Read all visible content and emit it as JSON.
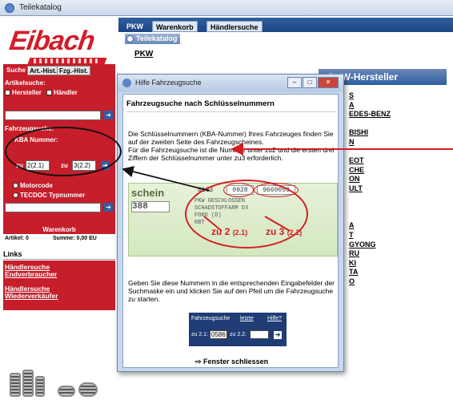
{
  "window": {
    "title": "Teilekatalog"
  },
  "sidebar": {
    "logo_text": "Eibach",
    "tabs": [
      "Suche",
      "Art.-Hist.",
      "Fzg.-Hist."
    ],
    "artikelsuche_label": "Artikelsuche:",
    "hersteller_label": "Hersteller",
    "haendler_label": "Händler",
    "fahrzeugsuche_label": "Fahrzeugsuche:",
    "kba_label": "KBA Nummer:",
    "kba_zu2_label": "zu",
    "kba_zu2_value": "2(2.1)",
    "kba_zu3_label": "zu",
    "kba_zu3_value": "3(2.2)",
    "motorcode_label": "Motorcode",
    "tecdoc_label": "TECDOC Typnummer",
    "warenkorb_label": "Warenkorb",
    "artikel_label": "Artikel: 0",
    "summe_label": "Summe: 0,00 EU",
    "links_label": "Links",
    "link1_line1": "Händlersuche",
    "link1_line2": "Endverbraucher",
    "link2_line1": "Händlersuche",
    "link2_line2": "Wiederverkäufer"
  },
  "main": {
    "tabs": [
      "PKW",
      "Warenkorb",
      "Händlersuche"
    ],
    "subtab": "Teilekatalog",
    "pkw_label": "PKW",
    "hersteller_header": "PKW-Hersteller",
    "manufacturers": [
      "S",
      "A",
      "EDES-BENZ",
      "",
      "BISHI",
      "N",
      "",
      "EOT",
      "CHE",
      "ON",
      "ULT",
      "",
      "",
      "",
      "A",
      "T",
      "GYONG",
      "RU",
      "KI",
      "TA",
      "O"
    ]
  },
  "dialog": {
    "title": "Hilfe Fahrzeugsuche",
    "heading": "Fahrzeugsuche nach Schlüsselnummern",
    "para1": "Die Schlüsselnummern (KBA-Nummer) Ihres Fahrzeuges finden Sie auf der zweiten Seite des Fahrzeugscheines.",
    "para2": "Für die Fahrzeugsuche ist die Nummer unter zu2 und die ersten drei Ziffern der Schlüsselnummer unter zu3 erforderlich.",
    "doc_schein": "schein",
    "doc_code": "388",
    "doc_num1": "0103",
    "doc_num2": "0928",
    "doc_num3": "9660053",
    "doc_line1": "PKW GESCHLOSSEN",
    "doc_line2": "SCHADSTOFFARM D3",
    "doc_line3": "FORD (D)",
    "doc_line4": "RBT",
    "zu2_label": "zu 2",
    "zu2_sub": "(2.1)",
    "zu3_label": "zu 3",
    "zu3_sub": "(2.2)",
    "para3": "Geben Sie diese Nummern in die entsprechenden Eingabefelder der Suchmaske ein und klicken Sie auf den Pfeil um die Fahrzeugsuche zu starten.",
    "form_title": "Fahrzeugsuche",
    "form_letzte": "letzte",
    "form_hilfe": "Hilfe?",
    "form_zu21": "zu 2.1:",
    "form_zu21_value": "0586",
    "form_zu22": "zu 2.2:",
    "form_zu22_value": "",
    "close_label": "Fenster schliessen"
  },
  "colors": {
    "eibach_red": "#c61e2a",
    "nav_blue": "#2f5fa0",
    "annotation_red": "#d31e24"
  }
}
